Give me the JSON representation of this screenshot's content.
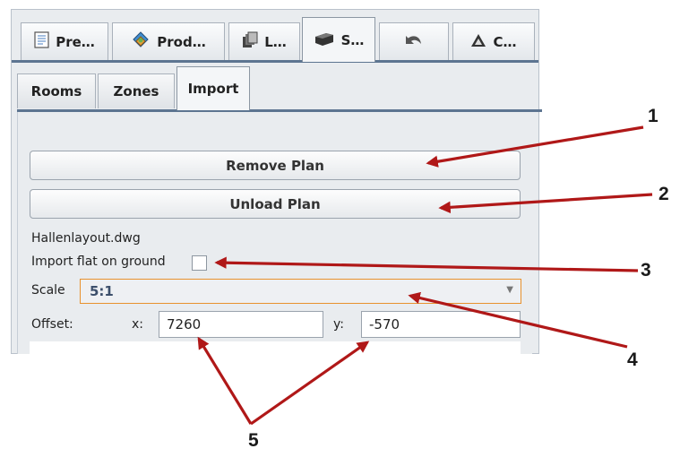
{
  "top_tabs": [
    {
      "label": "Pre…",
      "icon": "document-icon"
    },
    {
      "label": "Prod…",
      "icon": "products-icon"
    },
    {
      "label": "L…",
      "icon": "layers-icon"
    },
    {
      "label": "S…",
      "icon": "box-icon",
      "active": true
    },
    {
      "label": "",
      "icon": "undo-icon"
    },
    {
      "label": "C…",
      "icon": "triangle-icon"
    }
  ],
  "sub_tabs": [
    {
      "label": "Rooms"
    },
    {
      "label": "Zones"
    },
    {
      "label": "Import",
      "active": true
    }
  ],
  "panel": {
    "remove_plan_label": "Remove Plan",
    "unload_plan_label": "Unload Plan",
    "filename": "Hallenlayout.dwg",
    "import_flat_label": "Import flat on ground",
    "scale_label": "Scale",
    "scale_value": "5:1",
    "offset_label": "Offset:",
    "x_label": "x:",
    "x_value": "7260",
    "y_label": "y:",
    "y_value": "-570"
  },
  "annotations": {
    "n1": "1",
    "n2": "2",
    "n3": "3",
    "n4": "4",
    "n5": "5",
    "arrow_color": "#b01818"
  },
  "colors": {
    "tab_strip": "#5d7591",
    "select_border": "#e8912d",
    "panel_bg": "#e9ecef"
  }
}
